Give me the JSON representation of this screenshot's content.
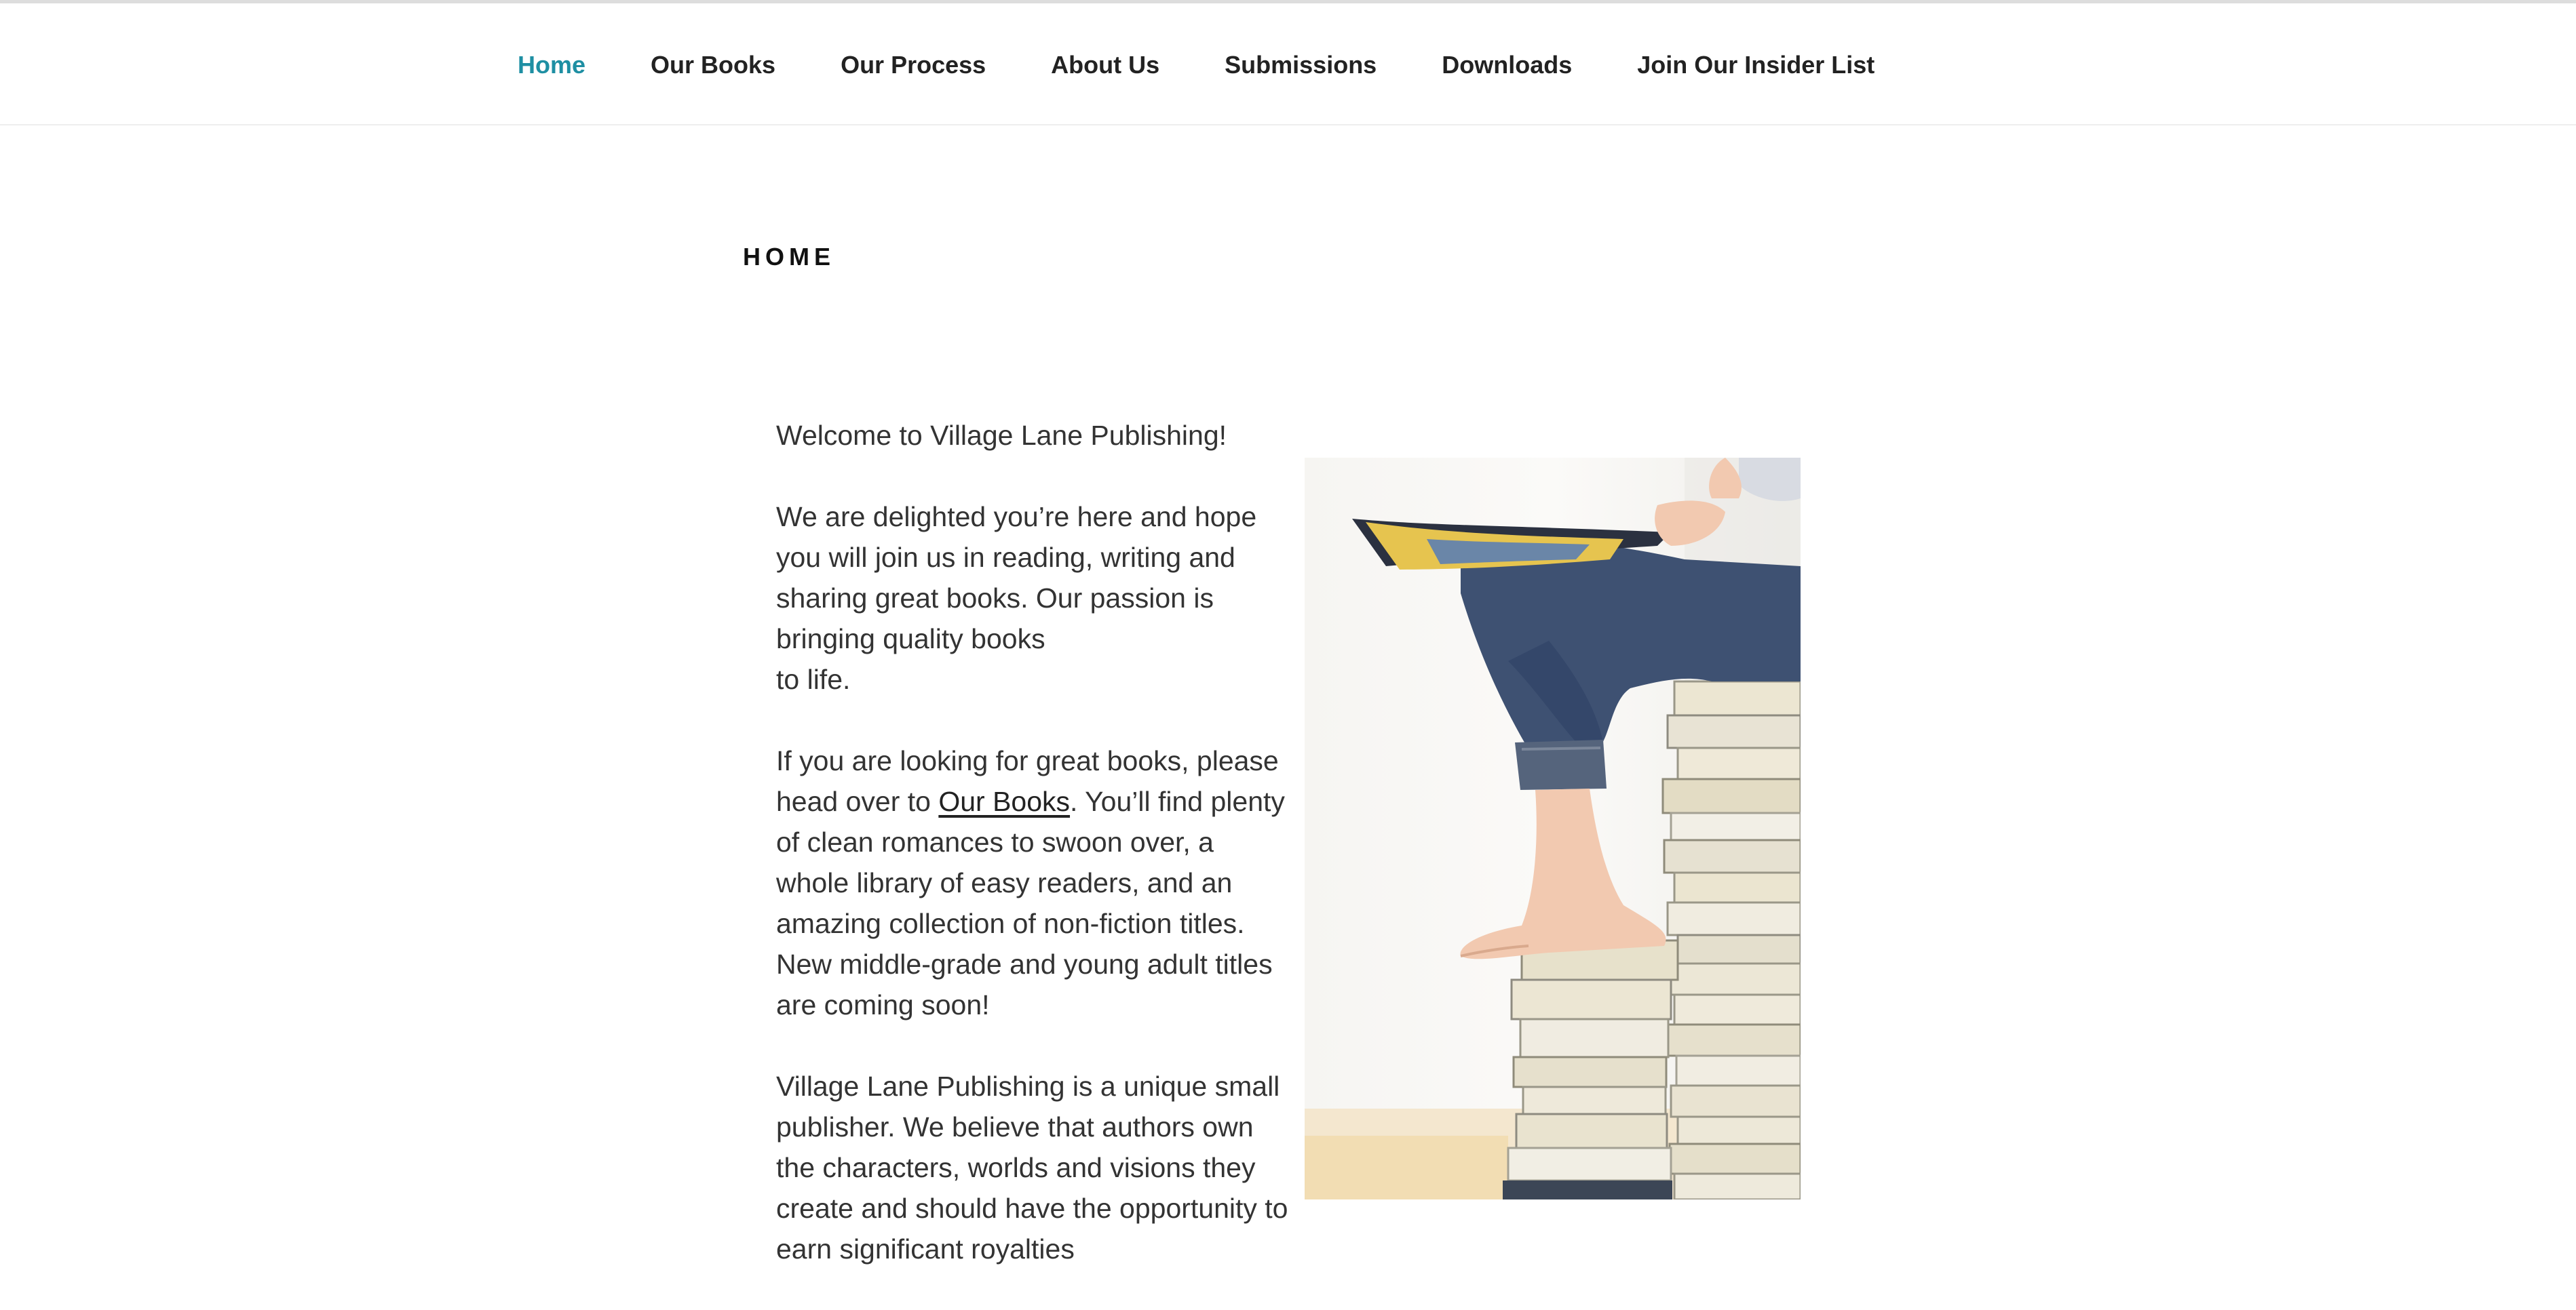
{
  "nav": {
    "items": [
      {
        "label": "Home",
        "active": true
      },
      {
        "label": "Our Books",
        "active": false
      },
      {
        "label": "Our Process",
        "active": false
      },
      {
        "label": "About Us",
        "active": false
      },
      {
        "label": "Submissions",
        "active": false
      },
      {
        "label": "Downloads",
        "active": false
      },
      {
        "label": "Join Our Insider List",
        "active": false
      }
    ],
    "active_color": "#1e8fa3"
  },
  "page": {
    "heading": "HOME"
  },
  "content": {
    "welcome": "Welcome to Village Lane Publishing!",
    "para1_line1": "We are delighted you’re here and hope you will join us in reading, writing and sharing great books. Our passion is bringing quality books",
    "para1_line2": "to life.",
    "para2_before": "If you are looking for great books, please head over to ",
    "para2_link": "Our Books",
    "para2_after": ". You’ll find plenty of clean romances to swoon over, a whole library of easy readers, and an amazing collection of non-fiction titles. New middle-grade and young adult titles are coming soon!",
    "para3": "Village Lane Publishing is a unique small publisher. We believe that authors own the characters, worlds and visions they create and should have the opportunity to earn significant royalties"
  },
  "image": {
    "subject": "child-reading-on-book-stacks-photo"
  }
}
